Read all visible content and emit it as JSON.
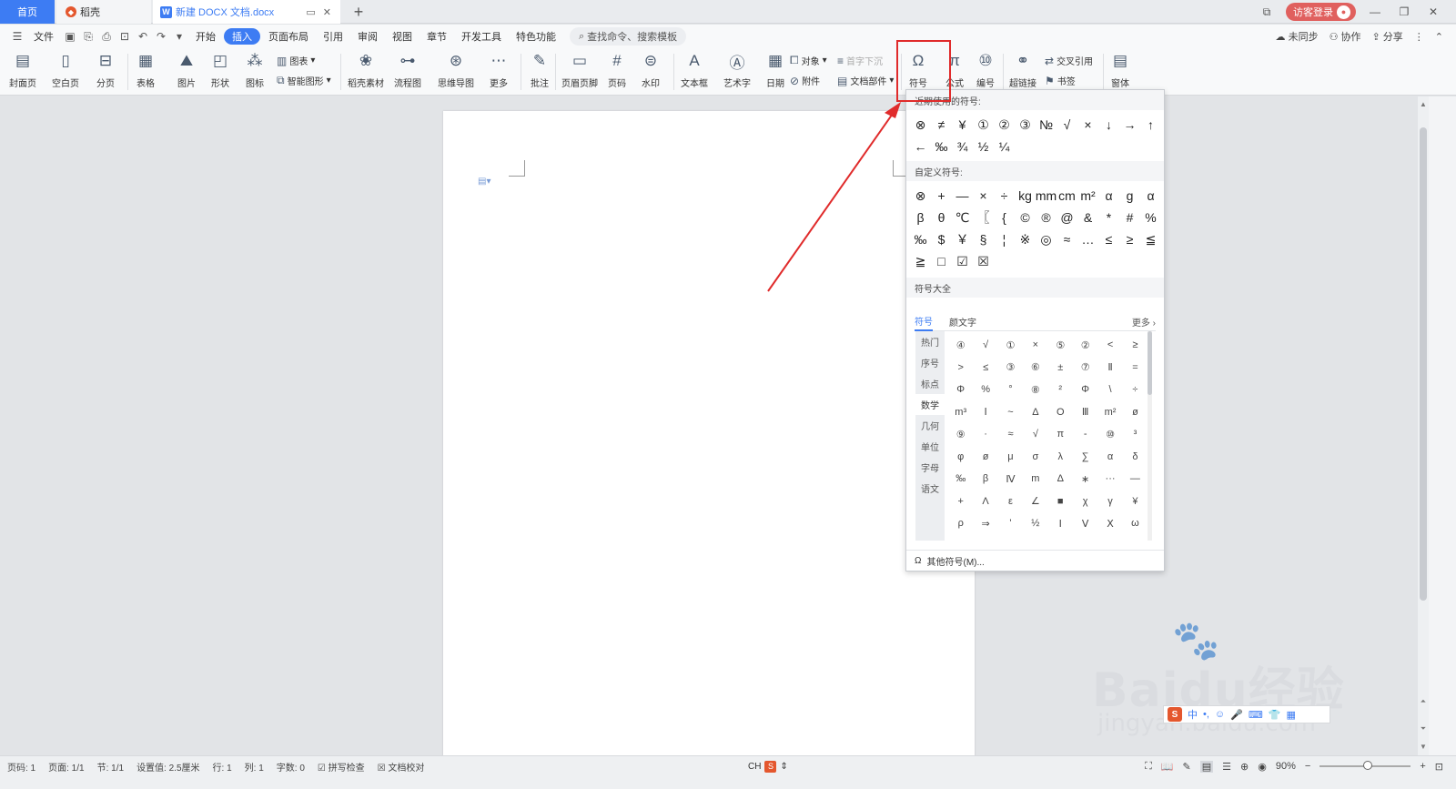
{
  "tabs": {
    "home": "首页",
    "daoke": "稻壳",
    "doc": "新建 DOCX 文档.docx"
  },
  "account": {
    "login_label": "访客登录"
  },
  "menu": {
    "file": "文件",
    "items": [
      "开始",
      "插入",
      "页面布局",
      "引用",
      "审阅",
      "视图",
      "章节",
      "开发工具",
      "特色功能"
    ],
    "active": "插入",
    "search": "查找命令、搜索模板",
    "right": {
      "sync": "未同步",
      "collab": "协作",
      "share": "分享"
    }
  },
  "ribbon": {
    "cover": "封面页",
    "blank": "空白页",
    "pagebreak": "分页",
    "table": "表格",
    "picture": "图片",
    "shape": "形状",
    "iconlib": "图标",
    "chart": "图表",
    "smartart": "智能图形",
    "daoke_material": "稻壳素材",
    "flowchart": "流程图",
    "mindmap": "思维导图",
    "more": "更多",
    "comment": "批注",
    "header_footer": "页眉页脚",
    "pagenum": "页码",
    "watermark": "水印",
    "textbox": "文本框",
    "wordart": "艺术字",
    "date": "日期",
    "object": "对象",
    "attachment": "附件",
    "dropcap": "首字下沉",
    "docpart": "文档部件",
    "symbol": "符号",
    "formula": "公式",
    "numbering": "编号",
    "hyperlink": "超链接",
    "crossref": "交叉引用",
    "bookmark": "书签",
    "window": "窗体"
  },
  "symbol_popup": {
    "recent_title": "近期使用的符号:",
    "recent": [
      "⊗",
      "≠",
      "¥",
      "①",
      "②",
      "③",
      "№",
      "√",
      "×",
      "↓",
      "→",
      "↑",
      "←",
      "‰",
      "¾",
      "½",
      "¼"
    ],
    "custom_title": "自定义符号:",
    "custom": [
      "⊗",
      "+",
      "—",
      "×",
      "÷",
      "kg",
      "mm",
      "cm",
      "m²",
      "α",
      "g",
      "α",
      "β",
      "θ",
      "℃",
      "〖",
      "{",
      "©",
      "®",
      "@",
      "&",
      "*",
      "#",
      "%",
      "‰",
      "$",
      "￥",
      "§",
      "¦",
      "※",
      "◎",
      "≈",
      "…",
      "≤",
      "≥",
      "≦",
      "≧",
      "□",
      "☑",
      "☒"
    ],
    "all_title": "符号大全",
    "subtabs": {
      "symbols": "符号",
      "kaomoji": "颜文字",
      "more": "更多"
    },
    "categories": [
      "热门",
      "序号",
      "标点",
      "数学",
      "几何",
      "单位",
      "字母",
      "语文"
    ],
    "selected_category": "数学",
    "grid": [
      "④",
      "√",
      "①",
      "×",
      "⑤",
      "②",
      "<",
      "≥",
      ">",
      "≤",
      "③",
      "⑥",
      "±",
      "⑦",
      "Ⅱ",
      "=",
      "Φ",
      "%",
      "°",
      "⑧",
      "²",
      "Φ",
      "\\",
      "÷",
      "m³",
      "Ⅰ",
      "~",
      "Δ",
      "O",
      "Ⅲ",
      "m²",
      "ø",
      "⑨",
      "·",
      "≈",
      "√",
      "π",
      "-",
      "⑩",
      "³",
      "φ",
      "ø",
      "μ",
      "σ",
      "λ",
      "∑",
      "α",
      "δ",
      "‰",
      "β",
      "Ⅳ",
      "m",
      "Δ",
      "∗",
      "···",
      "—",
      "+",
      "Λ",
      "ε",
      "∠",
      "■",
      "χ",
      "γ",
      "¥",
      "ρ",
      "⇒",
      "'",
      "½",
      "Ⅰ",
      "Ⅴ",
      "Ⅹ",
      "ω"
    ],
    "footer": "其他符号(M)..."
  },
  "status": {
    "page_num": "页码: 1",
    "pages": "页面: 1/1",
    "section": "节: 1/1",
    "setting": "设置值: 2.5厘米",
    "row": "行: 1",
    "col": "列: 1",
    "wordcount": "字数: 0",
    "spellcheck": "拼写检查",
    "proofread": "文档校对",
    "ime": "CH",
    "zoom": "90%"
  },
  "watermark": {
    "brand": "Baidu经验",
    "url": "jingyan.baidu.com"
  },
  "colors": {
    "accent": "#3d7cf3",
    "highlight": "#e02b2b"
  }
}
